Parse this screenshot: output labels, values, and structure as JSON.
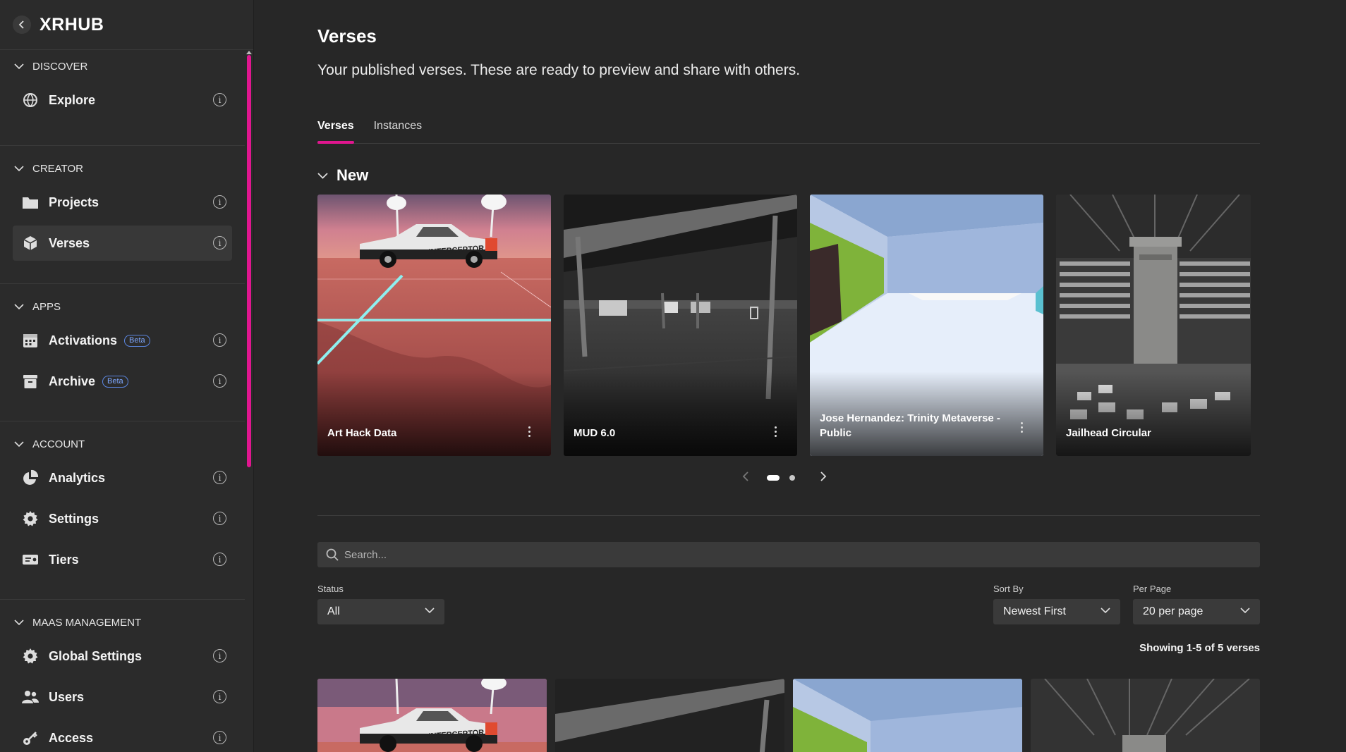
{
  "app": {
    "title": "XRHUB"
  },
  "sidebar": {
    "sections": [
      {
        "label": "DISCOVER",
        "items": [
          {
            "label": "Explore",
            "icon": "globe-icon"
          }
        ]
      },
      {
        "label": "CREATOR",
        "items": [
          {
            "label": "Projects",
            "icon": "folder-icon"
          },
          {
            "label": "Verses",
            "icon": "cube-icon",
            "active": true
          }
        ]
      },
      {
        "label": "APPS",
        "items": [
          {
            "label": "Activations",
            "icon": "calendar-icon",
            "badge": "Beta"
          },
          {
            "label": "Archive",
            "icon": "archive-icon",
            "badge": "Beta"
          }
        ]
      },
      {
        "label": "ACCOUNT",
        "items": [
          {
            "label": "Analytics",
            "icon": "pie-chart-icon"
          },
          {
            "label": "Settings",
            "icon": "gear-icon"
          },
          {
            "label": "Tiers",
            "icon": "ticket-icon"
          }
        ]
      },
      {
        "label": "MAAS MANAGEMENT",
        "items": [
          {
            "label": "Global Settings",
            "icon": "gear-icon"
          },
          {
            "label": "Users",
            "icon": "users-icon"
          },
          {
            "label": "Access",
            "icon": "key-icon"
          }
        ]
      }
    ],
    "accent": "#e0168f"
  },
  "page": {
    "title": "Verses",
    "subtitle": "Your published verses. These are ready to preview and share with others."
  },
  "tabs": [
    {
      "label": "Verses",
      "active": true
    },
    {
      "label": "Instances",
      "active": false
    }
  ],
  "new_section": {
    "title": "New",
    "cards": [
      {
        "title": "Art Hack Data"
      },
      {
        "title": "MUD 6.0"
      },
      {
        "title": "Jose Hernandez: Trinity Metaverse - Public"
      },
      {
        "title": "Jailhead Circular"
      }
    ],
    "pager": {
      "pages": 2,
      "current": 1
    }
  },
  "filters": {
    "search_placeholder": "Search...",
    "status_label": "Status",
    "status_value": "All",
    "sort_label": "Sort By",
    "sort_value": "Newest First",
    "per_page_label": "Per Page",
    "per_page_value": "20 per page"
  },
  "results": {
    "showing": "Showing 1-5 of 5 verses"
  }
}
